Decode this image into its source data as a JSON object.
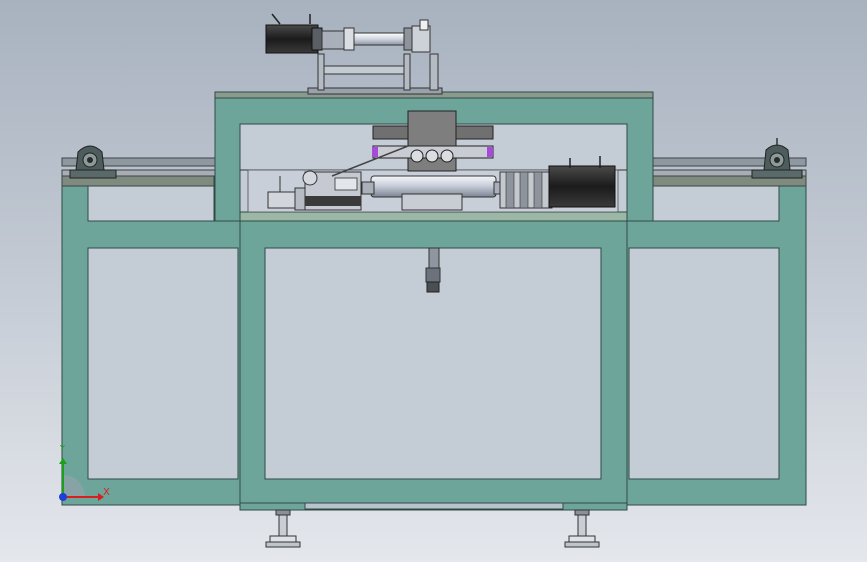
{
  "axis_triad": {
    "x_label": "X",
    "y_label": "Y",
    "x_color": "#d62020",
    "y_color": "#1aa01a",
    "z_color": "#1f3fd6"
  },
  "colors": {
    "background_top": "#a8b2bf",
    "background_bottom": "#e4e7ec",
    "frame_fill": "#6ea59b",
    "frame_stroke": "#2e4a45",
    "panel_fill": "#c4ccd6",
    "plate_fill": "#d9dcd6",
    "motor_fill": "#2d2d2d",
    "shaft_fill": "#dfe3ea",
    "accent_purple": "#a64bd9"
  }
}
